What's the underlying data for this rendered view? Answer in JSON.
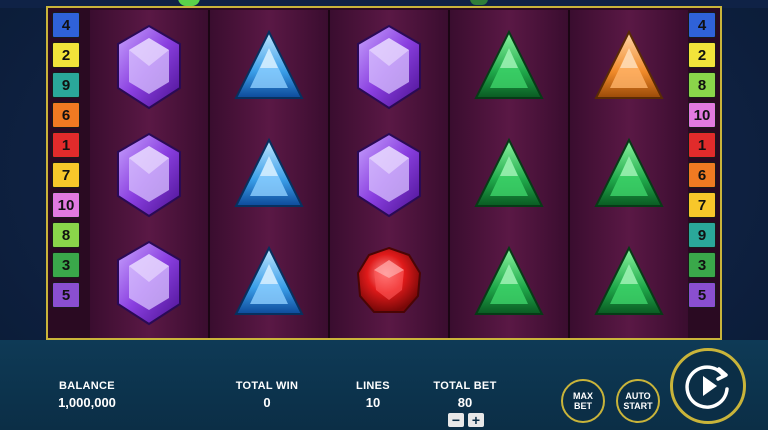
{
  "left_lines": [
    "4",
    "2",
    "9",
    "6",
    "1",
    "7",
    "10",
    "8",
    "3",
    "5"
  ],
  "right_lines": [
    "4",
    "2",
    "8",
    "10",
    "1",
    "6",
    "7",
    "9",
    "3",
    "5"
  ],
  "line_colors": {
    "1": "#e12b2b",
    "2": "#f2e43a",
    "3": "#3aa84a",
    "4": "#2f62d8",
    "5": "#8a4fd0",
    "6": "#f07a22",
    "7": "#f8c72a",
    "8": "#8ad54a",
    "9": "#2aa89a",
    "10": "#e27ae0"
  },
  "reels": [
    [
      "purple-gem-icon",
      "purple-gem-icon",
      "purple-gem-icon"
    ],
    [
      "blue-gem-icon",
      "blue-gem-icon",
      "blue-gem-icon"
    ],
    [
      "purple-gem-icon",
      "purple-gem-icon",
      "red-gem-icon"
    ],
    [
      "green-gem-icon",
      "green-gem-icon",
      "green-gem-icon"
    ],
    [
      "orange-gem-icon",
      "green-gem-icon",
      "green-gem-icon"
    ]
  ],
  "bottom": {
    "balance_label": "BALANCE",
    "balance_value": "1,000,000",
    "total_win_label": "TOTAL WIN",
    "total_win_value": "0",
    "lines_label": "LINES",
    "lines_value": "10",
    "total_bet_label": "TOTAL BET",
    "total_bet_value": "80",
    "minus": "−",
    "plus": "+",
    "max_bet_line1": "MAX",
    "max_bet_line2": "BET",
    "auto_start_line1": "AUTO",
    "auto_start_line2": "START"
  }
}
